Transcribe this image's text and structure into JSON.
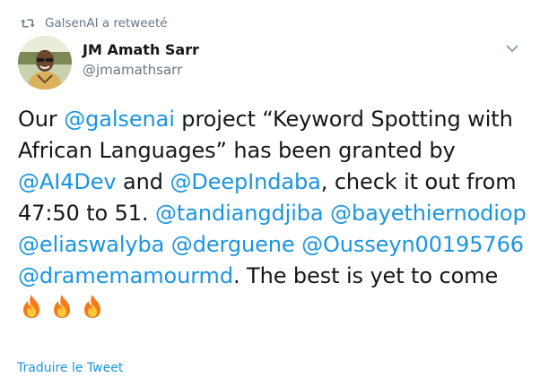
{
  "retweet": {
    "icon": "retweet-icon",
    "text": "GalsenAI a retweeté"
  },
  "author": {
    "display_name": "JM Amath Sarr",
    "handle": "@jmamathsarr",
    "avatar": "avatar-photo"
  },
  "menu": {
    "icon": "chevron-down-icon"
  },
  "tweet": {
    "t1": "Our ",
    "m1": "@galsenai",
    "t2": " project “Keyword Spotting with African Languages” has been granted by ",
    "m2": "@AI4Dev",
    "t3": " and ",
    "m3": "@DeepIndaba",
    "t4": ", check it out from 47:50 to 51. ",
    "m4": "@tandiangdjiba",
    "t5": " ",
    "m5": "@bayethiernodiop",
    "t6": " ",
    "m6": "@eliaswalyba",
    "t7": " ",
    "m7": "@derguene",
    "t8": " ",
    "m8": "@Ousseyn00195766",
    "t9": " ",
    "m9": "@dramemamourmd",
    "t10": ". The best is yet to come ",
    "emoji": [
      "fire-emoji",
      "fire-emoji",
      "fire-emoji"
    ]
  },
  "footer": {
    "translate_label": "Traduire le Tweet"
  },
  "colors": {
    "link": "#1b95e0",
    "text": "#14171a",
    "muted": "#657786"
  }
}
